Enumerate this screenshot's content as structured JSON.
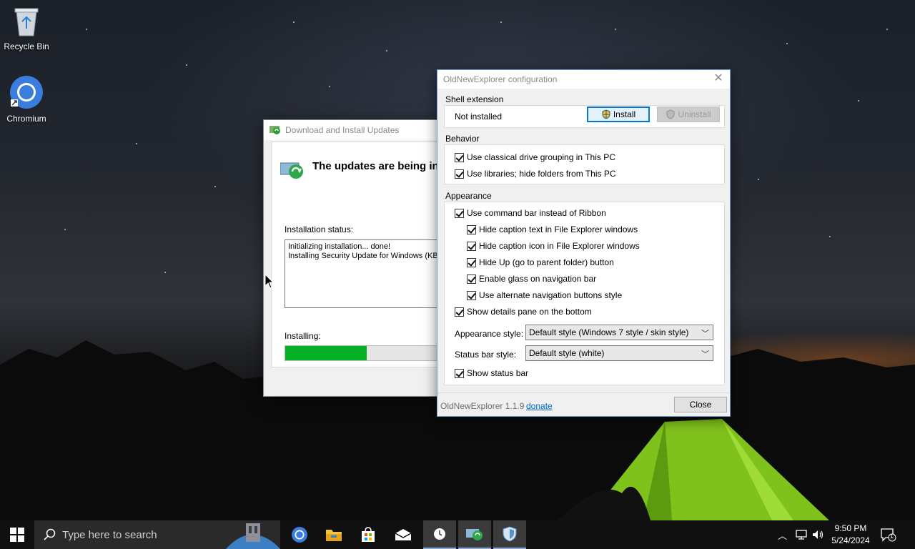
{
  "desktop": {
    "icons": [
      {
        "label": "Recycle Bin",
        "icon": "recycle-bin-icon"
      },
      {
        "label": "Chromium",
        "icon": "chromium-icon"
      }
    ]
  },
  "update_window": {
    "title": "Download and Install Updates",
    "headline": "The updates are being ins",
    "status_label": "Installation status:",
    "log_lines": [
      "Initializing installation... done!",
      "Installing Security Update for Windows (KB5"
    ],
    "installing_label": "Installing:",
    "progress": 0.5
  },
  "config_window": {
    "title": "OldNewExplorer configuration",
    "shell_extension": {
      "label": "Shell extension",
      "status": "Not installed",
      "install_button": "Install",
      "uninstall_button": "Uninstall"
    },
    "behavior": {
      "label": "Behavior",
      "options": [
        {
          "label": "Use classical drive grouping in This PC",
          "checked": true
        },
        {
          "label": "Use libraries; hide folders from This PC",
          "checked": true
        }
      ]
    },
    "appearance": {
      "label": "Appearance",
      "use_command_bar": "Use command bar instead of Ribbon",
      "sub_options": [
        "Hide caption text in File Explorer windows",
        "Hide caption icon in File Explorer windows",
        "Hide Up (go to parent folder) button",
        "Enable glass on navigation bar",
        "Use alternate navigation buttons style"
      ],
      "details_pane": "Show details pane on the bottom",
      "appearance_style_label": "Appearance style:",
      "appearance_style_value": "Default style (Windows 7 style / skin style)",
      "status_bar_style_label": "Status bar style:",
      "status_bar_style_value": "Default style (white)",
      "show_status_bar": "Show status bar"
    },
    "footer": {
      "version": "OldNewExplorer 1.1.9",
      "donate_link": "donate",
      "close_button": "Close"
    }
  },
  "taskbar": {
    "search_placeholder": "Type here to search",
    "time": "9:50 PM",
    "date": "5/24/2024",
    "notification_count": "1",
    "pinned": [
      "chromium-icon",
      "file-explorer-icon",
      "store-icon",
      "mail-icon",
      "clock-icon",
      "windows-update-icon",
      "shield-icon"
    ]
  },
  "colors": {
    "progress_fill": "#06b025",
    "accent": "#0078d7",
    "link": "#0066cc"
  }
}
